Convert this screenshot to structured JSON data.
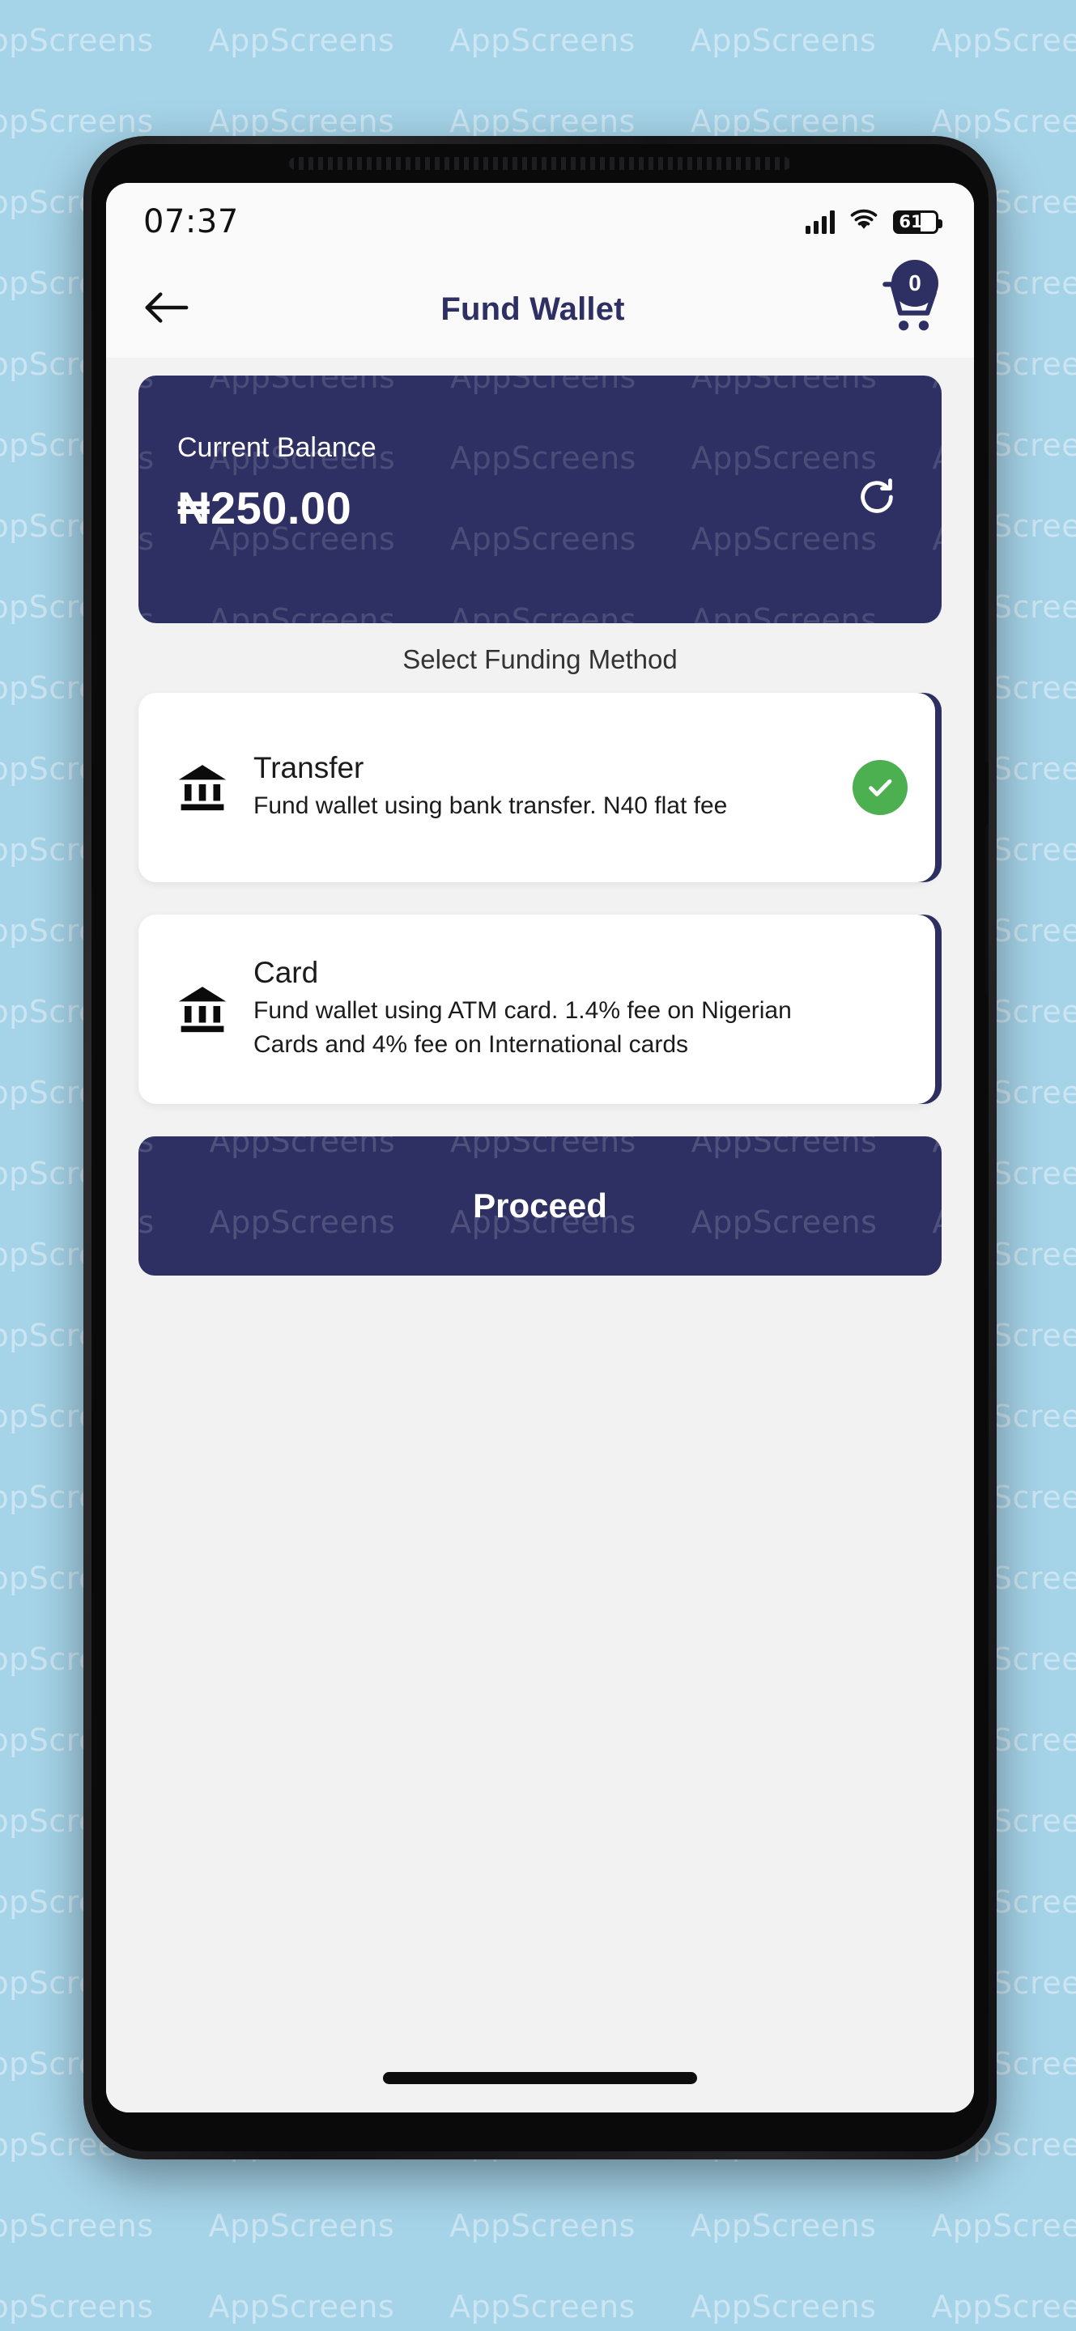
{
  "background": {
    "color": "#a5d3e8",
    "watermark_text": "AppScreens"
  },
  "theme": {
    "navy": "#2e3063",
    "green": "#4caf50",
    "screen_bg": "#f2f2f2",
    "card_white": "#ffffff"
  },
  "statusbar": {
    "time": "07:37",
    "battery_percent": "61",
    "battery_level": 61,
    "signal_icon": "signal-bars-icon",
    "wifi_icon": "wifi-icon",
    "battery_icon": "battery-icon"
  },
  "appbar": {
    "back_icon": "back-arrow-icon",
    "title": "Fund Wallet",
    "cart_icon": "shopping-cart-icon",
    "cart_badge_count": "0"
  },
  "balance": {
    "label": "Current Balance",
    "amount": "₦250.00",
    "refresh_icon": "refresh-icon"
  },
  "funding": {
    "section_title": "Select Funding Method",
    "options": [
      {
        "icon": "bank-icon",
        "title": "Transfer",
        "description": "Fund wallet using bank transfer. N40 flat fee",
        "selected": true,
        "check_icon": "check-circle-icon"
      },
      {
        "icon": "bank-icon",
        "title": "Card",
        "description": "Fund wallet using ATM card. 1.4% fee on Nigerian Cards and 4% fee on International cards",
        "selected": false,
        "check_icon": "check-circle-icon"
      }
    ]
  },
  "proceed": {
    "label": "Proceed"
  },
  "system": {
    "home_indicator": "home-indicator"
  }
}
